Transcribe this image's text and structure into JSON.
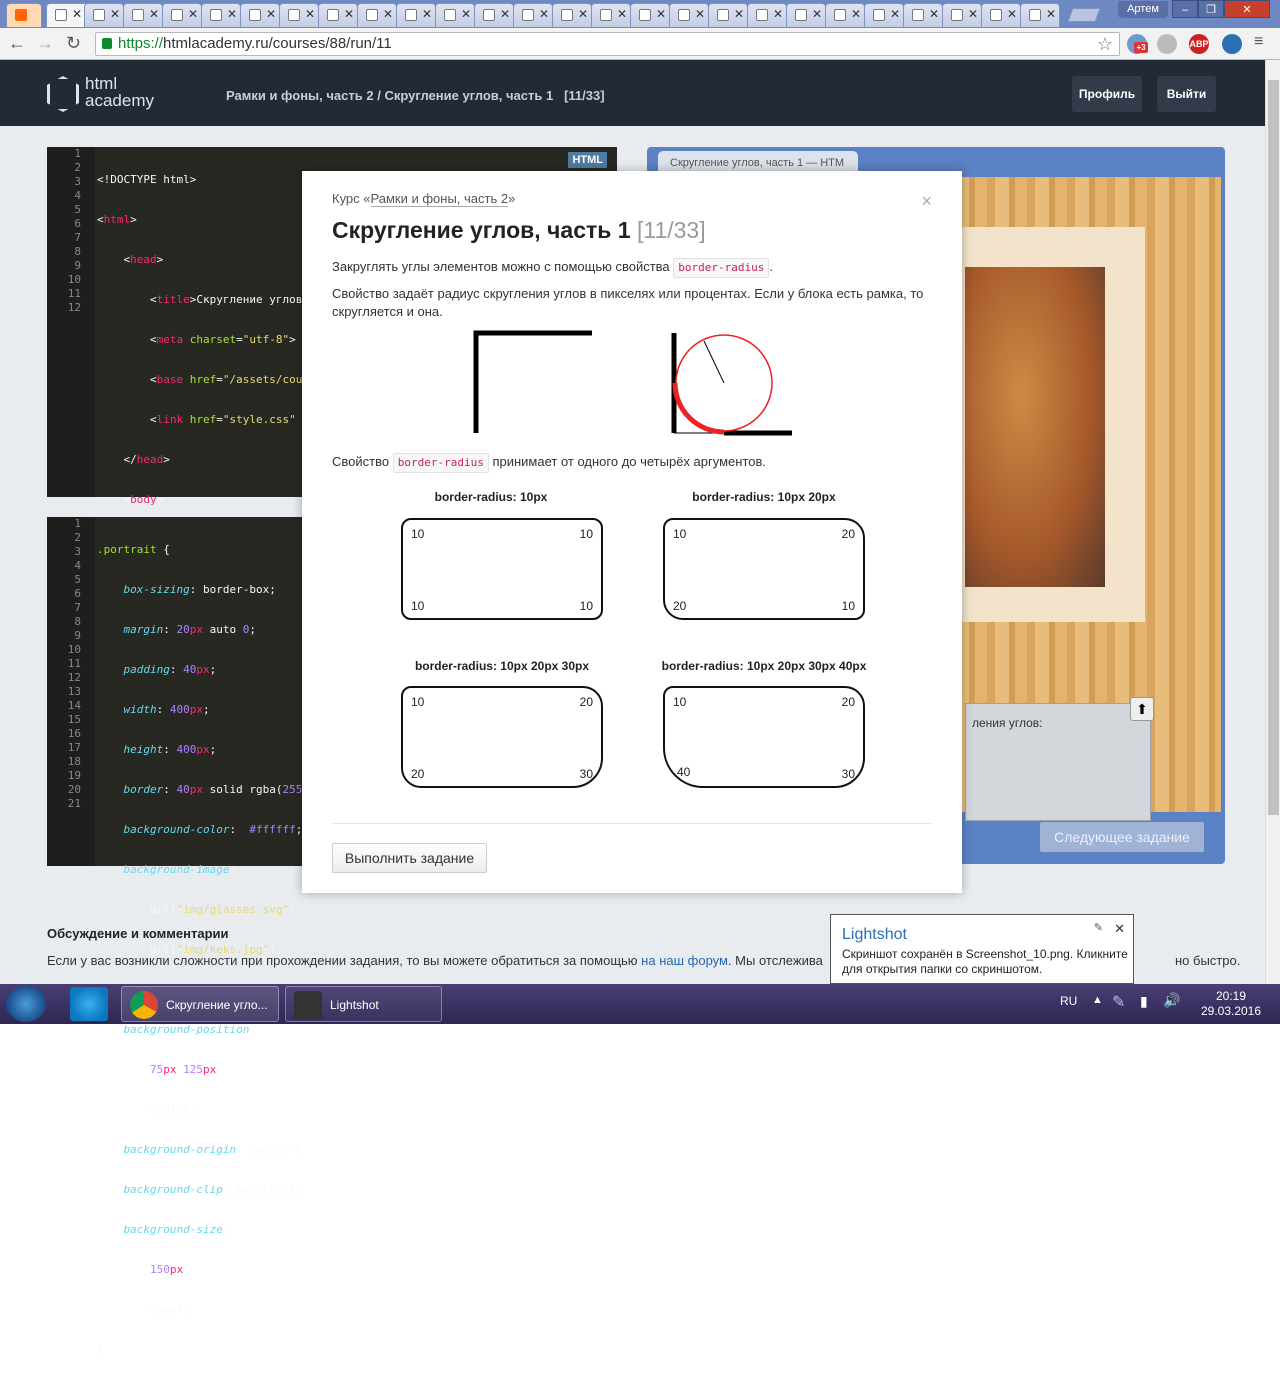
{
  "browser": {
    "url_scheme": "https://",
    "url_rest": "htmlacademy.ru/courses/88/run/11",
    "user_button": "Артем",
    "ext_badge": "+3",
    "abp_label": "ABP"
  },
  "site": {
    "logo_line1": "html",
    "logo_line2": "academy",
    "breadcrumb_parent": "Рамки и фоны, часть 2 /",
    "breadcrumb_current": "Скругление углов, часть 1",
    "breadcrumb_count": "[11/33]",
    "profile_button": "Профиль",
    "logout_button": "Выйти"
  },
  "html_editor": {
    "badge": "HTML",
    "line_numbers": [
      "1",
      "2",
      "3",
      "4",
      "5",
      "6",
      "7",
      "8",
      "9",
      "10",
      "11",
      "12"
    ]
  },
  "css_editor": {
    "line_numbers": [
      "1",
      "2",
      "3",
      "4",
      "5",
      "6",
      "7",
      "8",
      "9",
      "10",
      "11",
      "12",
      "13",
      "14",
      "15",
      "16",
      "17",
      "18",
      "19",
      "20",
      "21"
    ]
  },
  "preview": {
    "tab_title": "Скругление углов, часть 1 — HTM",
    "task_text": "ления углов:",
    "next_button": "Следующее задание"
  },
  "modal": {
    "course_prefix": "Курс «",
    "course_link": "Рамки и фоны, часть 2",
    "course_suffix": "»",
    "close": "×",
    "title": "Скругление углов, часть 1",
    "title_count": "[11/33]",
    "p1_before": "Закруглять углы элементов можно с помощью свойства",
    "p1_code": "border-radius",
    "p1_after": ".",
    "p2": "Свойство задаёт радиус скругления углов в пикселях или процентах. Если у блока есть рамка, то скругляется и она.",
    "p3_before": "Свойство",
    "p3_code": "border-radius",
    "p3_after": "принимает от одного до четырёх аргументов.",
    "examples": [
      {
        "label": "border-radius: 10px",
        "tl": "10",
        "tr": "10",
        "bl": "10",
        "br": "10"
      },
      {
        "label": "border-radius: 10px 20px",
        "tl": "10",
        "tr": "20",
        "bl": "20",
        "br": "10"
      },
      {
        "label": "border-radius: 10px 20px 30px",
        "tl": "10",
        "tr": "20",
        "bl": "20",
        "br": "30"
      },
      {
        "label": "border-radius: 10px 20px 30px 40px",
        "tl": "10",
        "tr": "20",
        "bl": "40",
        "br": "30"
      }
    ],
    "run_button": "Выполнить задание"
  },
  "discussion": {
    "title": "Обсуждение и комментарии",
    "text_before": "Если у вас возникли сложности при прохождении задания, то вы можете обратиться за помощью",
    "link": "на наш форум",
    "text_after": ". Мы отслежива",
    "tail": "но быстро."
  },
  "lightshot": {
    "title": "Lightshot",
    "body": "Скриншот сохранён в Screenshot_10.png. Кликните для открытия папки со скриншотом.",
    "close": "✕"
  },
  "taskbar": {
    "app1": "Скругление угло...",
    "app2": "Lightshot",
    "lang": "RU",
    "time": "20:19",
    "date": "29.03.2016"
  },
  "colors": {
    "header_bg": "#222a35",
    "editor_bg": "#272822",
    "preview_border": "#5b82c4",
    "code_red": "#c7254e",
    "link_blue": "#2467b3"
  }
}
